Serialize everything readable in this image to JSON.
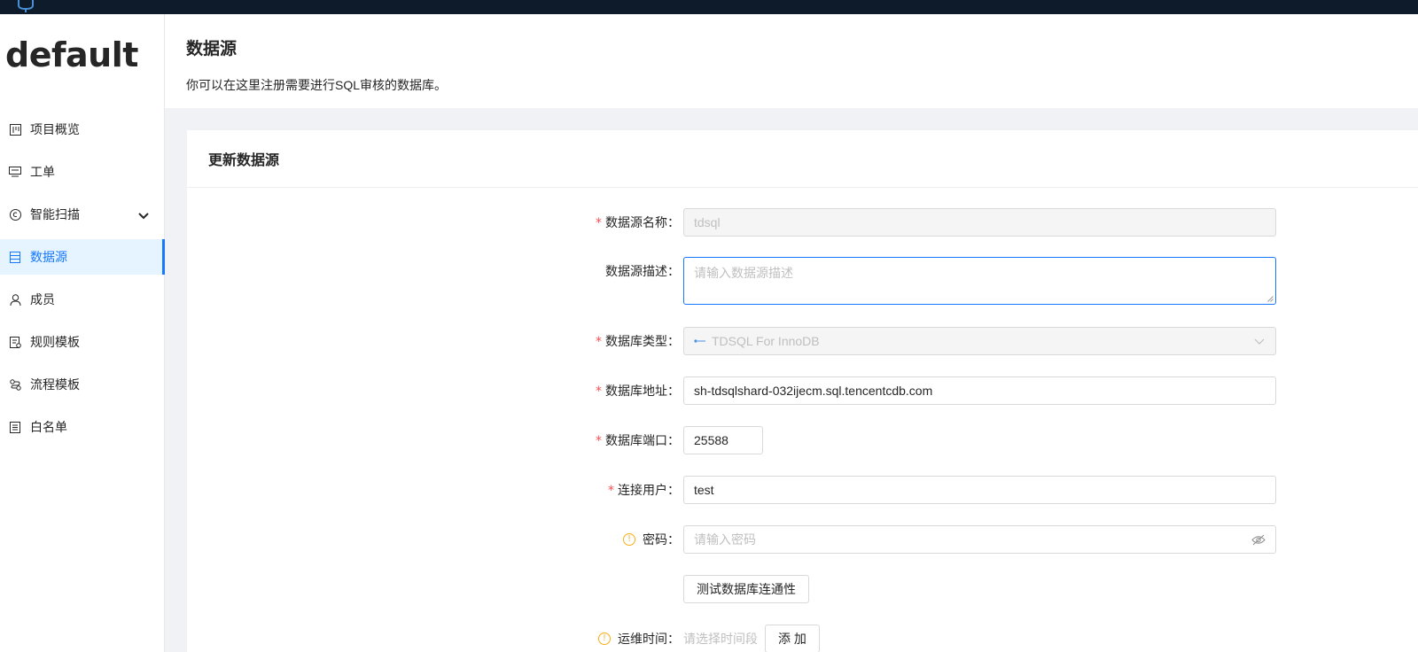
{
  "sidebar": {
    "project_name": "default",
    "items": [
      {
        "label": "项目概览",
        "icon": "project-overview-icon"
      },
      {
        "label": "工单",
        "icon": "order-icon"
      },
      {
        "label": "智能扫描",
        "icon": "scan-icon"
      },
      {
        "label": "数据源",
        "icon": "database-icon",
        "active": true
      },
      {
        "label": "成员",
        "icon": "user-icon"
      },
      {
        "label": "规则模板",
        "icon": "rule-template-icon"
      },
      {
        "label": "流程模板",
        "icon": "workflow-template-icon"
      },
      {
        "label": "白名单",
        "icon": "whitelist-icon"
      }
    ]
  },
  "header": {
    "title": "数据源",
    "description": "你可以在这里注册需要进行SQL审核的数据库。"
  },
  "form": {
    "card_title": "更新数据源",
    "name_label": "数据源名称",
    "name_value": "tdsql",
    "desc_label": "数据源描述",
    "desc_placeholder": "请输入数据源描述",
    "type_label": "数据库类型",
    "type_value": "TDSQL For InnoDB",
    "host_label": "数据库地址",
    "host_value": "sh-tdsqlshard-032ijecm.sql.tencentcdb.com",
    "port_label": "数据库端口",
    "port_value": "25588",
    "user_label": "连接用户",
    "user_value": "test",
    "password_label": "密码",
    "password_placeholder": "请输入密码",
    "test_button": "测试数据库连通性",
    "maintenance_label": "运维时间",
    "maintenance_placeholder": "请选择时间段",
    "add_button": "添 加",
    "colon": "："
  },
  "colors": {
    "accent": "#1677ff",
    "required": "#ff4d4f",
    "warning": "#faad14",
    "topbar": "#0d1b2a"
  }
}
